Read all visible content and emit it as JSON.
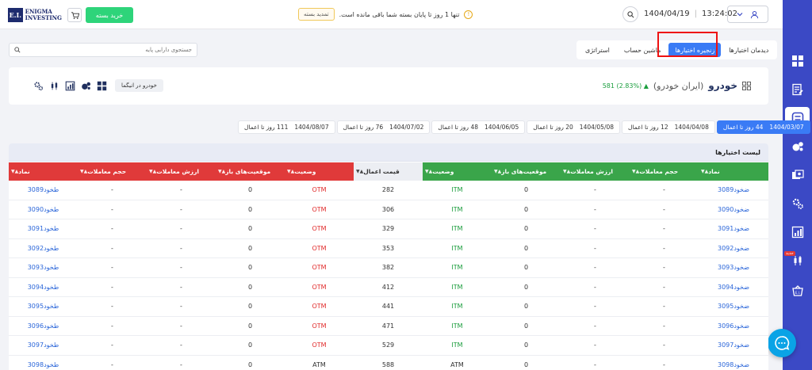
{
  "header": {
    "logo_mark": "E.I.",
    "logo_line1": "Enigma",
    "logo_line2": "Investing",
    "buy_label": "خرید بسته",
    "renew_label": "تمدید بسته",
    "notice": "تنها 1 روز تا پایان بسته شما باقی مانده است.",
    "date": "1404/04/19",
    "time": "13:24:02"
  },
  "search": {
    "placeholder": "جستجوی دارایی پایه"
  },
  "tabs": [
    {
      "label": "دیدمان اختیارها"
    },
    {
      "label": "زنجیره اختیارها"
    },
    {
      "label": "ماشین حساب"
    },
    {
      "label": "استراتژی"
    }
  ],
  "asset": {
    "symbol": "خودرو",
    "name": "(ایران خودرو)",
    "price": "581",
    "change": "(2.83%)",
    "insta_label": "خودرو در انیگما"
  },
  "expiries": [
    {
      "date": "1404/03/07",
      "days": "44 روز تا اعمال"
    },
    {
      "date": "1404/04/08",
      "days": "12 روز تا اعمال"
    },
    {
      "date": "1404/05/08",
      "days": "20 روز تا اعمال"
    },
    {
      "date": "1404/06/05",
      "days": "48 روز تا اعمال"
    },
    {
      "date": "1404/07/02",
      "days": "76 روز تا اعمال"
    },
    {
      "date": "1404/08/07",
      "days": "111 روز تا اعمال"
    }
  ],
  "table": {
    "title": "لیست اختیارها",
    "headers": {
      "call_symbol": "نماد",
      "call_volume": "حجم معاملات",
      "call_value": "ارزش معاملات",
      "call_oi": "موقعیت‌های باز",
      "call_status": "وضعیت",
      "strike": "قیمت اعمال",
      "put_status": "وضعیت",
      "put_oi": "موقعیت‌های باز",
      "put_value": "ارزش معاملات",
      "put_volume": "حجم معاملات",
      "put_symbol": "نماد"
    },
    "rows": [
      {
        "call": "ضخود3089",
        "cvol": "-",
        "cval": "-",
        "coi": "0",
        "cst": "ITM",
        "strike": "282",
        "pst": "OTM",
        "poi": "0",
        "pval": "-",
        "pvol": "-",
        "put": "طخود3089"
      },
      {
        "call": "ضخود3090",
        "cvol": "-",
        "cval": "-",
        "coi": "0",
        "cst": "ITM",
        "strike": "306",
        "pst": "OTM",
        "poi": "0",
        "pval": "-",
        "pvol": "-",
        "put": "طخود3090"
      },
      {
        "call": "ضخود3091",
        "cvol": "-",
        "cval": "-",
        "coi": "0",
        "cst": "ITM",
        "strike": "329",
        "pst": "OTM",
        "poi": "0",
        "pval": "-",
        "pvol": "-",
        "put": "طخود3091"
      },
      {
        "call": "ضخود3092",
        "cvol": "-",
        "cval": "-",
        "coi": "0",
        "cst": "ITM",
        "strike": "353",
        "pst": "OTM",
        "poi": "0",
        "pval": "-",
        "pvol": "-",
        "put": "طخود3092"
      },
      {
        "call": "ضخود3093",
        "cvol": "-",
        "cval": "-",
        "coi": "0",
        "cst": "ITM",
        "strike": "382",
        "pst": "OTM",
        "poi": "0",
        "pval": "-",
        "pvol": "-",
        "put": "طخود3093"
      },
      {
        "call": "ضخود3094",
        "cvol": "-",
        "cval": "-",
        "coi": "0",
        "cst": "ITM",
        "strike": "412",
        "pst": "OTM",
        "poi": "0",
        "pval": "-",
        "pvol": "-",
        "put": "طخود3094"
      },
      {
        "call": "ضخود3095",
        "cvol": "-",
        "cval": "-",
        "coi": "0",
        "cst": "ITM",
        "strike": "441",
        "pst": "OTM",
        "poi": "0",
        "pval": "-",
        "pvol": "-",
        "put": "طخود3095"
      },
      {
        "call": "ضخود3096",
        "cvol": "-",
        "cval": "-",
        "coi": "0",
        "cst": "ITM",
        "strike": "471",
        "pst": "OTM",
        "poi": "0",
        "pval": "-",
        "pvol": "-",
        "put": "طخود3096"
      },
      {
        "call": "ضخود3097",
        "cvol": "-",
        "cval": "-",
        "coi": "0",
        "cst": "ITM",
        "strike": "529",
        "pst": "OTM",
        "poi": "0",
        "pval": "-",
        "pvol": "-",
        "put": "طخود3097"
      },
      {
        "call": "ضخود3098",
        "cvol": "-",
        "cval": "-",
        "coi": "0",
        "cst": "ATM",
        "strike": "588",
        "pst": "ATM",
        "poi": "0",
        "pval": "-",
        "pvol": "-",
        "put": "طخود3098"
      }
    ]
  },
  "colors": {
    "call_header": "#3aa54a",
    "put_header": "#e03a3a",
    "strike_header": "#eceef3",
    "accent": "#3a7bf5",
    "sidebar": "#3b49c5"
  },
  "sidebar": {
    "items": [
      {
        "icon": "dashboard-icon"
      },
      {
        "icon": "edit-list-icon"
      },
      {
        "icon": "option-chain-icon"
      },
      {
        "icon": "pie-chart-icon"
      },
      {
        "icon": "money-stack-icon"
      },
      {
        "icon": "gears-icon"
      },
      {
        "icon": "bar-chart-icon"
      },
      {
        "icon": "candlestick-icon",
        "badge": "جدید"
      },
      {
        "icon": "basket-icon"
      }
    ]
  }
}
